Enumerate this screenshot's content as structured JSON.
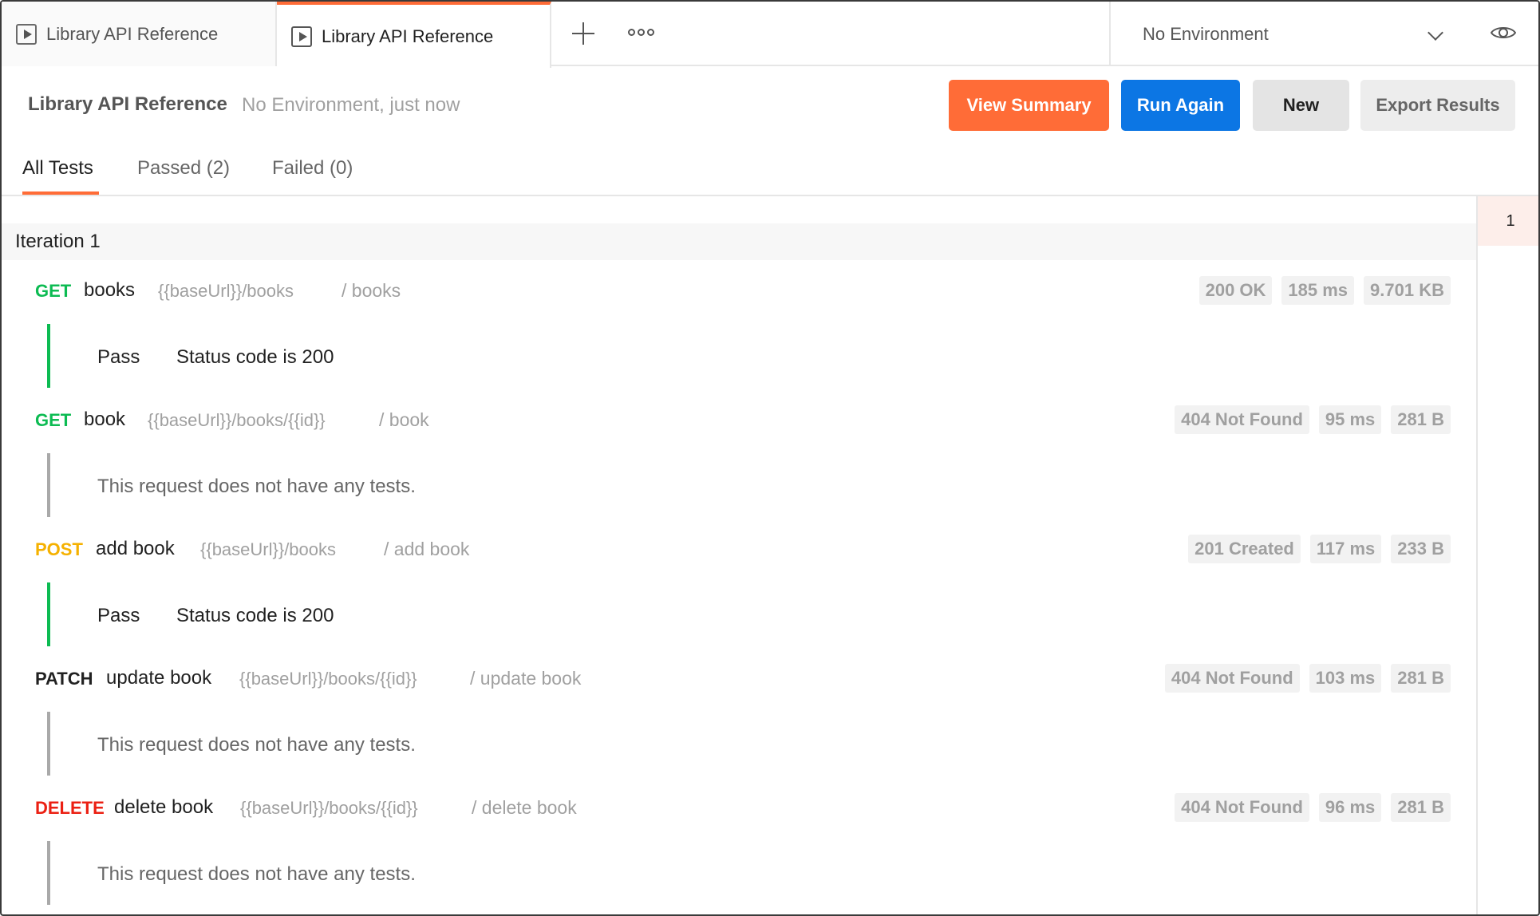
{
  "tabs": [
    {
      "label": "Library API Reference"
    },
    {
      "label": "Library API Reference"
    }
  ],
  "environment": {
    "selected": "No Environment"
  },
  "header": {
    "title": "Library API Reference",
    "meta": "No Environment, just now",
    "buttons": {
      "view_summary": "View Summary",
      "run_again": "Run Again",
      "new": "New",
      "export": "Export Results"
    }
  },
  "filters": {
    "all": "All Tests",
    "passed": "Passed (2)",
    "failed": "Failed (0)"
  },
  "rail": {
    "iteration_number": "1"
  },
  "iteration": {
    "label": "Iteration 1"
  },
  "colors": {
    "get": "#0cbb52",
    "post": "#f5b100",
    "delete": "#eb2013",
    "accent": "#ff6c37",
    "primary": "#0c76e4"
  },
  "requests": [
    {
      "method": "GET",
      "name": "books",
      "url": "{{baseUrl}}/books",
      "path": "/ books",
      "status": "200 OK",
      "time": "185 ms",
      "size": "9.701 KB",
      "test": {
        "result": "Pass",
        "name": "Status code is 200",
        "empty": ""
      }
    },
    {
      "method": "GET",
      "name": "book",
      "url": "{{baseUrl}}/books/{{id}}",
      "path": "/ book",
      "status": "404 Not Found",
      "time": "95 ms",
      "size": "281 B",
      "test": {
        "result": "",
        "name": "",
        "empty": "This request does not have any tests."
      }
    },
    {
      "method": "POST",
      "name": "add book",
      "url": "{{baseUrl}}/books",
      "path": "/ add book",
      "status": "201 Created",
      "time": "117 ms",
      "size": "233 B",
      "test": {
        "result": "Pass",
        "name": "Status code is 200",
        "empty": ""
      }
    },
    {
      "method": "PATCH",
      "name": "update book",
      "url": "{{baseUrl}}/books/{{id}}",
      "path": "/ update book",
      "status": "404 Not Found",
      "time": "103 ms",
      "size": "281 B",
      "test": {
        "result": "",
        "name": "",
        "empty": "This request does not have any tests."
      }
    },
    {
      "method": "DELETE",
      "name": "delete book",
      "url": "{{baseUrl}}/books/{{id}}",
      "path": "/ delete book",
      "status": "404 Not Found",
      "time": "96 ms",
      "size": "281 B",
      "test": {
        "result": "",
        "name": "",
        "empty": "This request does not have any tests."
      }
    }
  ]
}
